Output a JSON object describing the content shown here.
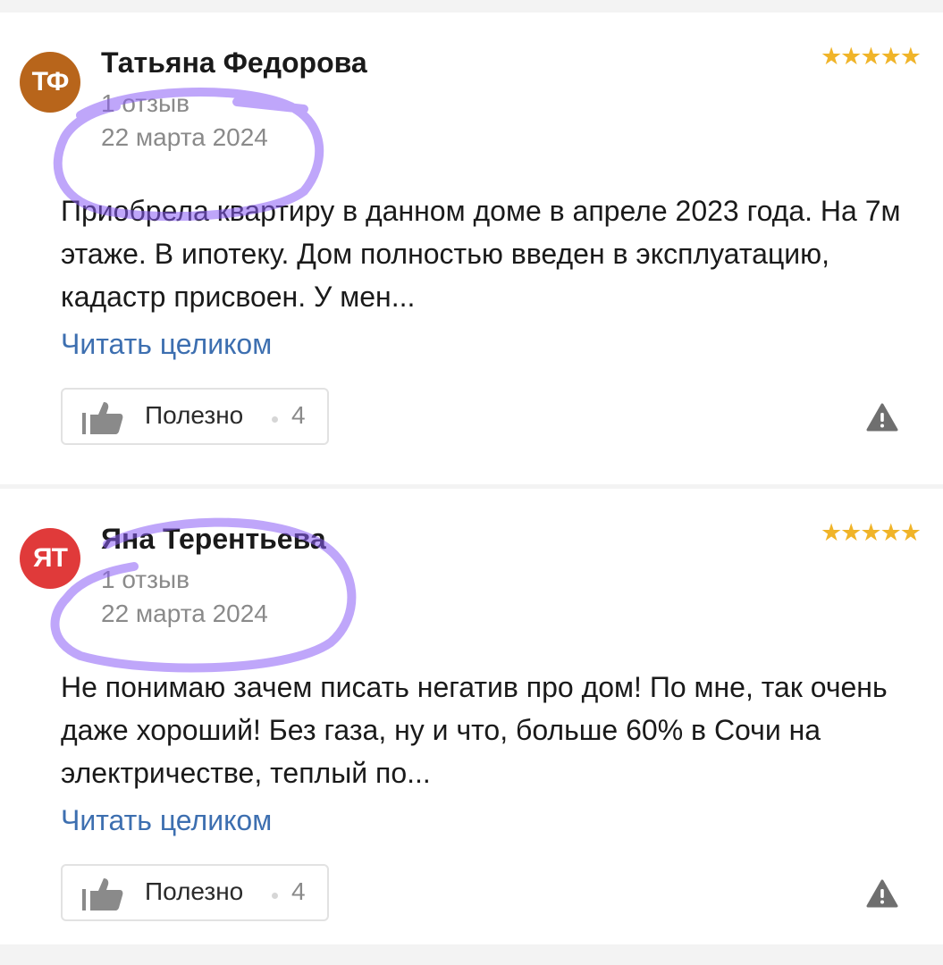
{
  "reviews": [
    {
      "avatar_initials": "ТФ",
      "avatar_color": "#b8651b",
      "author": "Татьяна Федорова",
      "reviews_count": "1 отзыв",
      "date": "22 марта 2024",
      "rating": 5,
      "stars": "★★★★★",
      "text": "Приобрела квартиру в данном доме в апреле 2023 года. На 7м этаже. В ипотеку. Дом полностью введен в эксплуатацию, кадастр присвоен. У мен...",
      "read_more": "Читать целиком",
      "helpful_label": "Полезно",
      "helpful_count": "4"
    },
    {
      "avatar_initials": "ЯТ",
      "avatar_color": "#e03a3a",
      "author": "Яна Терентьева",
      "reviews_count": "1 отзыв",
      "date": "22 марта 2024",
      "rating": 5,
      "stars": "★★★★★",
      "text": "Не понимаю зачем писать негатив про дом! По мне, так очень даже хороший! Без газа, ну и что, больше 60% в Сочи на электричестве, теплый по...",
      "read_more": "Читать целиком",
      "helpful_label": "Полезно",
      "helpful_count": "4"
    }
  ],
  "colors": {
    "star": "#f0b429",
    "link": "#3d6fb0",
    "highlight": "#8b5cf6"
  },
  "icons": {
    "helpful": "thumbs-up-icon",
    "report": "warning-triangle-icon"
  }
}
